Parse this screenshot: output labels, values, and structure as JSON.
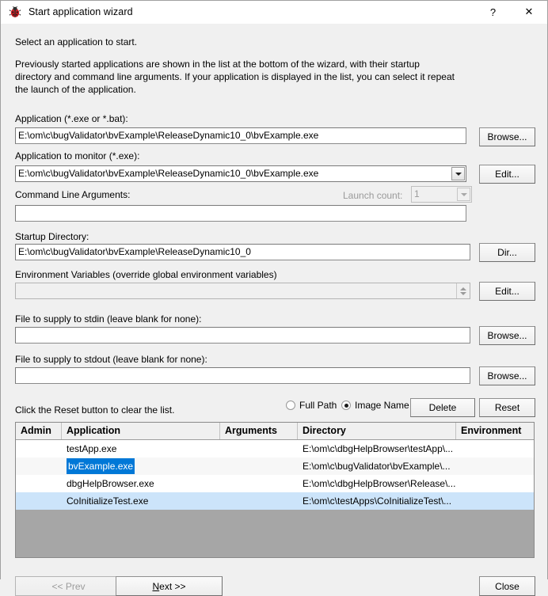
{
  "window": {
    "title": "Start application wizard",
    "icon": "bug-icon",
    "help_label": "?",
    "close_label": "✕"
  },
  "intro": {
    "line1": "Select an application to start.",
    "line2": "Previously started applications are shown in the list at the bottom of the wizard, with their startup directory and command line arguments. If your application is displayed in the list, you can select it repeat the launch of the application."
  },
  "fields": {
    "application": {
      "label": "Application (*.exe or *.bat):",
      "value": "E:\\om\\c\\bugValidator\\bvExample\\ReleaseDynamic10_0\\bvExample.exe",
      "button": "Browse..."
    },
    "application_to_monitor": {
      "label": "Application to monitor (*.exe):",
      "value": "E:\\om\\c\\bugValidator\\bvExample\\ReleaseDynamic10_0\\bvExample.exe",
      "button": "Edit..."
    },
    "command_line_arguments": {
      "label": "Command Line Arguments:",
      "value": ""
    },
    "launch_count": {
      "label": "Launch count:",
      "value": "1",
      "disabled": true
    },
    "startup_directory": {
      "label": "Startup Directory:",
      "value": "E:\\om\\c\\bugValidator\\bvExample\\ReleaseDynamic10_0",
      "button": "Dir..."
    },
    "environment_variables": {
      "label": "Environment Variables (override global environment variables)",
      "value": "",
      "button": "Edit..."
    },
    "stdin_file": {
      "label": "File to supply to stdin (leave blank for none):",
      "value": "",
      "button": "Browse..."
    },
    "stdout_file": {
      "label": "File to supply to stdout (leave blank for none):",
      "value": "",
      "button": "Browse..."
    }
  },
  "list_controls": {
    "hint": "Click the Reset button to clear the list.",
    "radio_full_path": "Full Path",
    "radio_image_name": "Image Name",
    "selected_radio": "Image Name",
    "delete_button": "Delete",
    "reset_button": "Reset"
  },
  "list": {
    "columns": [
      "Admin",
      "Application",
      "Arguments",
      "Directory",
      "Environment"
    ],
    "rows": [
      {
        "admin": "",
        "application": "testApp.exe",
        "arguments": "",
        "directory": "E:\\om\\c\\dbgHelpBrowser\\testApp\\...",
        "environment": "",
        "state": "normal"
      },
      {
        "admin": "",
        "application": "bvExample.exe",
        "arguments": "",
        "directory": "E:\\om\\c\\bugValidator\\bvExample\\...",
        "environment": "",
        "state": "focused"
      },
      {
        "admin": "",
        "application": "dbgHelpBrowser.exe",
        "arguments": "",
        "directory": "E:\\om\\c\\dbgHelpBrowser\\Release\\...",
        "environment": "",
        "state": "normal"
      },
      {
        "admin": "",
        "application": "CoInitializeTest.exe",
        "arguments": "",
        "directory": "E:\\om\\c\\testApps\\CoInitializeTest\\...",
        "environment": "",
        "state": "selected"
      }
    ]
  },
  "footer": {
    "prev_button": "<< Prev",
    "prev_disabled": true,
    "next_button_prefix": "",
    "next_button_mnemonic": "N",
    "next_button_suffix": "ext >>",
    "close_button": "Close"
  },
  "colors": {
    "accent": "#0078d7",
    "row_selected": "#cce4fa",
    "row_alt": "#f7f7f7",
    "listview_filler": "#a6a6a6",
    "dialog_bg": "#f0f0f0"
  }
}
